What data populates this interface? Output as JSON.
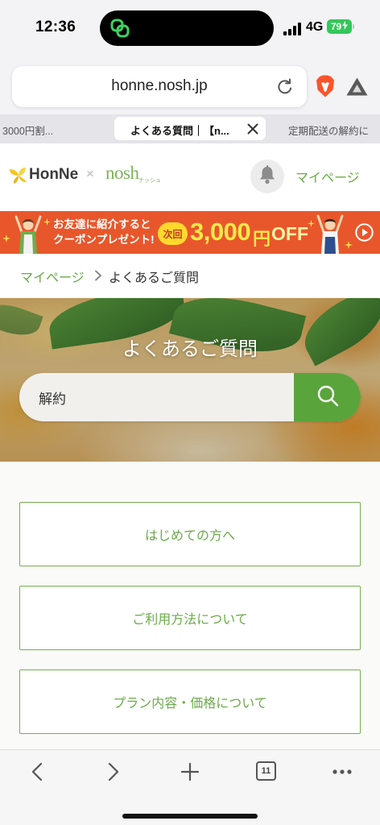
{
  "status_bar": {
    "time": "12:36",
    "network": "4G",
    "battery": "79"
  },
  "browser": {
    "url": "honne.nosh.jp",
    "tabs": [
      {
        "label": "3000円割...",
        "active": false
      },
      {
        "label": "よくある質問｜【n...",
        "active": true
      },
      {
        "label": "定期配送の解約に",
        "active": false
      }
    ],
    "tab_count": "11"
  },
  "site_header": {
    "brand_honne": "HonNe",
    "brand_separator": "×",
    "brand_nosh": "nosh",
    "brand_nosh_kana": "ナッシュ",
    "mypage_label": "マイページ"
  },
  "banner": {
    "line1": "お友達に紹介すると",
    "line2": "クーポンプレゼント!",
    "badge": "次回",
    "amount": "3,000",
    "unit": "円",
    "off": "OFF"
  },
  "breadcrumb": {
    "items": [
      "マイページ",
      "よくあるご質問"
    ]
  },
  "hero": {
    "title": "よくあるご質問",
    "search_value": "解約"
  },
  "categories": [
    "はじめての方へ",
    "ご利用方法について",
    "プラン内容・価格について"
  ],
  "colors": {
    "accent": "#6aab4a",
    "search_button": "#5aa43c",
    "banner_bg": "#e8572b",
    "banner_highlight": "#ffe84a",
    "battery": "#34c759",
    "brave": "#fb542b"
  },
  "icons": [
    "app-activity-icon",
    "signal-icon",
    "charging-bolt-icon",
    "reload-icon",
    "brave-lion-icon",
    "rewards-triangle-icon",
    "tab-close-icon",
    "honne-leaf-icon",
    "bell-icon",
    "sparkle-icon",
    "play-icon",
    "chevron-right-icon",
    "search-icon",
    "back-arrow-icon",
    "forward-arrow-icon",
    "new-tab-plus-icon",
    "more-dots-icon"
  ]
}
